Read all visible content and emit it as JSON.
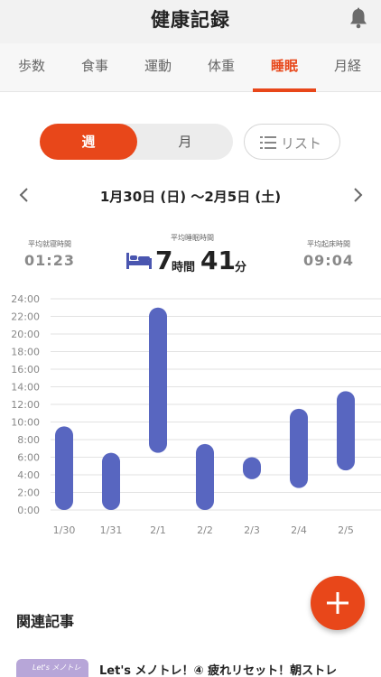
{
  "header": {
    "title": "健康記録"
  },
  "tabs": [
    {
      "label": "歩数"
    },
    {
      "label": "食事"
    },
    {
      "label": "運動"
    },
    {
      "label": "体重"
    },
    {
      "label": "睡眠"
    },
    {
      "label": "月経"
    }
  ],
  "active_tab": "睡眠",
  "period_toggle": {
    "week_label": "週",
    "month_label": "月",
    "selected": "週"
  },
  "list_button": {
    "label": "リスト"
  },
  "date_range": {
    "label": "1月30日 (日) 〜2月5日 (土)"
  },
  "stats": {
    "avg_bedtime": {
      "caption": "平均就寝時間",
      "value": "01:23"
    },
    "avg_sleep": {
      "caption": "平均睡眠時間",
      "hours": "7",
      "hours_unit": "時間",
      "minutes": "41",
      "minutes_unit": "分"
    },
    "avg_wake": {
      "caption": "平均起床時間",
      "value": "09:04"
    }
  },
  "chart_data": {
    "type": "bar",
    "y_ticks": [
      "0:00",
      "2:00",
      "4:00",
      "6:00",
      "8:00",
      "10:00",
      "12:00",
      "14:00",
      "16:00",
      "18:00",
      "20:00",
      "22:00",
      "24:00"
    ],
    "ylim": [
      0,
      24
    ],
    "categories": [
      "1/30",
      "1/31",
      "2/1",
      "2/2",
      "2/3",
      "2/4",
      "2/5"
    ],
    "series": [
      {
        "ranges_hours": [
          [
            0,
            9.5
          ],
          [
            0,
            6.5
          ],
          [
            6.5,
            23
          ],
          [
            0,
            7.5
          ],
          [
            3.5,
            6
          ],
          [
            2.5,
            11.5
          ],
          [
            4.5,
            13.5
          ]
        ]
      }
    ],
    "bar_color": "#5866c0",
    "grid": true
  },
  "related": {
    "title": "関連記事"
  },
  "articles": [
    {
      "thumb_text": "Let's メノトレ",
      "title": "Let's メノトレ！④ 疲れリセット！朝ストレ"
    }
  ]
}
